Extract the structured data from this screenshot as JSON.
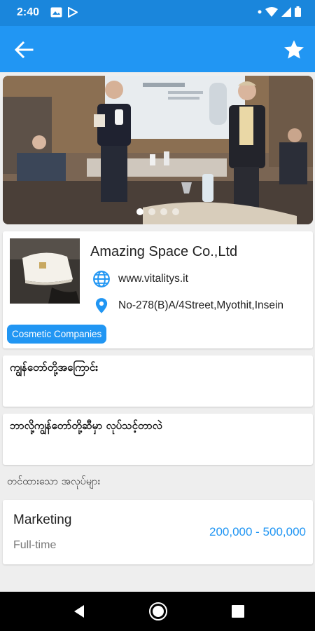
{
  "status_bar": {
    "time": "2:40"
  },
  "header": {
    "back_icon": "arrow-left-icon",
    "favorite_icon": "star-icon"
  },
  "carousel": {
    "slide_count": 4,
    "active_slide": 1
  },
  "company": {
    "name": "Amazing Space Co.,Ltd",
    "website": "www.vitalitys.it",
    "address": "No-278(B)A/4Street,Myothit,Insein",
    "category": "Cosmetic Companies"
  },
  "sections": {
    "about_title": "ကျွန်တော်တို့အကြောင်း",
    "services_title": "ဘာလို့ကျွန်တော်တို့ဆီမှာ လုပ်သင့်တာလဲ"
  },
  "jobs": {
    "heading": "တင်ထားသော အလုပ်များ",
    "items": [
      {
        "title": "Marketing",
        "type": "Full-time",
        "salary": "200,000 - 500,000"
      }
    ]
  },
  "colors": {
    "primary": "#2196f3",
    "status_bar": "#1a86dc"
  }
}
